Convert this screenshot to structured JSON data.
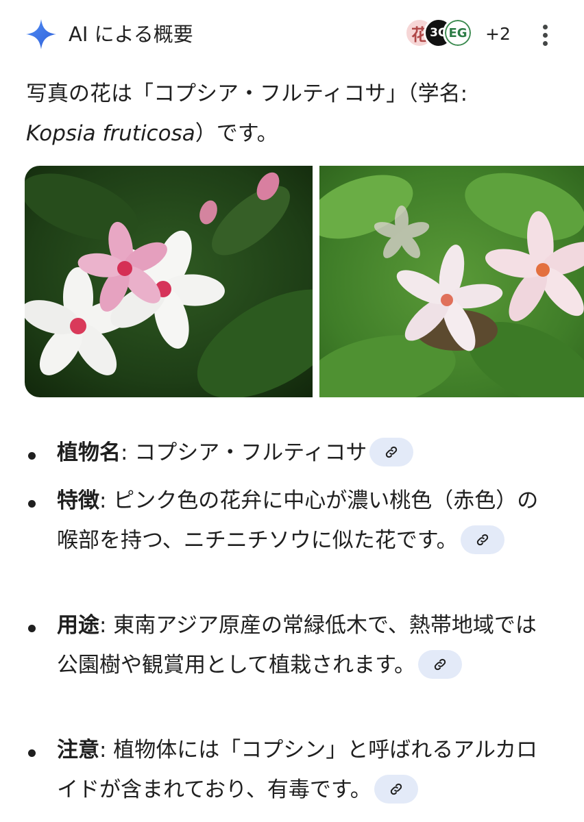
{
  "header": {
    "title": "AI による概要",
    "sources": [
      {
        "label": "花"
      },
      {
        "label": "3G"
      },
      {
        "label": "EG"
      }
    ],
    "sources_more": "+2"
  },
  "intro": {
    "line1": "写真の花は「コプシア・フルティコサ」（学名:",
    "scientific_name": "Kopsia fruticosa",
    "line2_suffix": "）です。"
  },
  "images": [
    {
      "description_icon": "flower-photo"
    },
    {
      "description_icon": "flower-photo"
    }
  ],
  "facts": [
    {
      "label": "植物名",
      "text": ": コプシア・フルティコサ"
    },
    {
      "label": "特徴",
      "text": ": ピンク色の花弁に中心が濃い桃色（赤色）の喉部を持つ、ニチニチソウに似た花です。"
    },
    {
      "label": "用途",
      "text": ": 東南アジア原産の常緑低木で、熱帯地域では公園樹や観賞用として植栽されます。"
    },
    {
      "label": "注意",
      "text": ": 植物体には「コプシン」と呼ばれるアルカロイドが含まれており、有毒です。"
    }
  ],
  "colors": {
    "sparkle_blue": "#3b6fe0",
    "chip_bg": "#e3eaf8",
    "text": "#1f1f1f"
  }
}
